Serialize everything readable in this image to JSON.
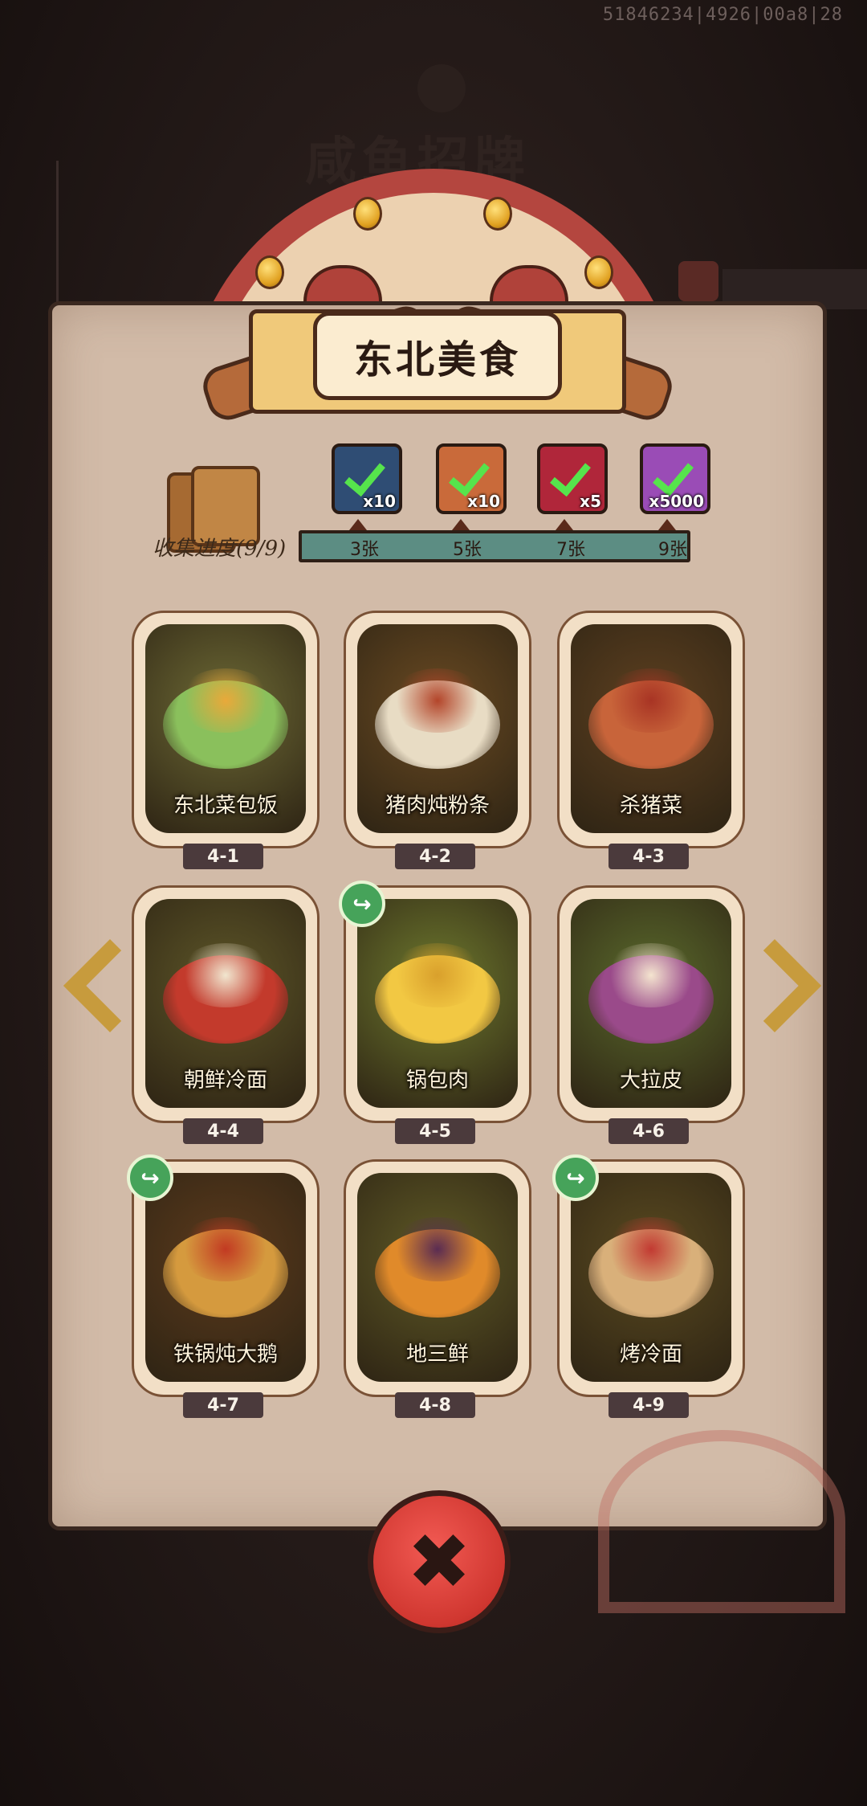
{
  "build_id": "51846234|4926|00a8|28",
  "background": {
    "faded_title": "咸鱼招牌"
  },
  "header": {
    "title": "东北美食"
  },
  "collection": {
    "progress_label": "收集进度(9/9)",
    "milestones": [
      "3张",
      "5张",
      "7张",
      "9张"
    ],
    "progress_fraction": 1.0,
    "rewards": [
      {
        "icon": "hammer-reward-icon",
        "count": "x10",
        "color": "#2f4d74",
        "claimed": true
      },
      {
        "icon": "wrench-reward-icon",
        "count": "x10",
        "color": "#c96a3a",
        "claimed": true
      },
      {
        "icon": "gem-reward-icon",
        "count": "x5",
        "color": "#b0263a",
        "claimed": true
      },
      {
        "icon": "silver-ingot-reward-icon",
        "count": "x5000",
        "color": "#9a4cb6",
        "claimed": true
      }
    ]
  },
  "dishes": [
    {
      "code": "4-1",
      "name": "东北菜包饭",
      "share": false,
      "bg": "#6d6a35",
      "color": "#8ac05c",
      "top": "#e9a93a"
    },
    {
      "code": "4-2",
      "name": "猪肉炖粉条",
      "share": false,
      "bg": "#6a4a22",
      "color": "#e8dcc4",
      "top": "#b3452a"
    },
    {
      "code": "4-3",
      "name": "杀猪菜",
      "share": false,
      "bg": "#5e4020",
      "color": "#c8643a",
      "top": "#a83424"
    },
    {
      "code": "4-4",
      "name": "朝鲜冷面",
      "share": false,
      "bg": "#5d5628",
      "color": "#c33a2c",
      "top": "#f1e6cf"
    },
    {
      "code": "4-5",
      "name": "锅包肉",
      "share": true,
      "bg": "#6e7a2e",
      "color": "#f2c843",
      "top": "#d9a02c"
    },
    {
      "code": "4-6",
      "name": "大拉皮",
      "share": false,
      "bg": "#5a6a2c",
      "color": "#9a4a8a",
      "top": "#f4e4cf"
    },
    {
      "code": "4-7",
      "name": "铁锅炖大鹅",
      "share": true,
      "bg": "#5c3a1c",
      "color": "#d59a3e",
      "top": "#c23a22"
    },
    {
      "code": "4-8",
      "name": "地三鲜",
      "share": false,
      "bg": "#5f5a26",
      "color": "#e08a2a",
      "top": "#5a2c52"
    },
    {
      "code": "4-9",
      "name": "烤冷面",
      "share": true,
      "bg": "#5a4a20",
      "color": "#d9b07a",
      "top": "#c23a32"
    }
  ],
  "nav": {
    "prev_icon": "chevron-left-icon",
    "next_icon": "chevron-right-icon"
  },
  "close": {
    "icon": "close-icon",
    "glyph": "✖"
  }
}
